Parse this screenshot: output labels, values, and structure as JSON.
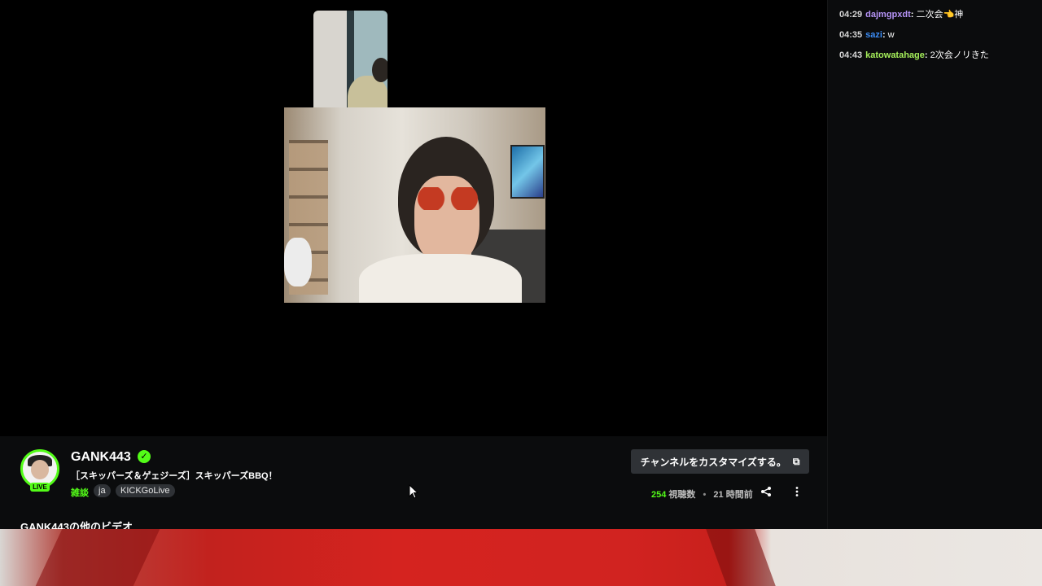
{
  "chat": {
    "messages": [
      {
        "time": "04:29",
        "user": "dajmgpxdt",
        "user_color": "#b694f7",
        "text": "二次会👈神"
      },
      {
        "time": "04:35",
        "user": "sazi",
        "user_color": "#3b8cf5",
        "text": "w"
      },
      {
        "time": "04:43",
        "user": "katowatahage",
        "user_color": "#a6f05a",
        "text": "2次会ノリきた"
      }
    ]
  },
  "channel": {
    "name": "GANK443",
    "verified_icon": "✓",
    "live_label": "LIVE",
    "stream_title": "［スキッパーズ＆ゲェジーズ］スキッパーズBBQ！",
    "category": "雑談",
    "tags": [
      "ja",
      "KICKGoLive"
    ]
  },
  "actions": {
    "customize_label": "チャンネルをカスタマイズする。",
    "external_icon": "⧉"
  },
  "stats": {
    "viewers": "254",
    "viewers_label": "視聴数",
    "separator": "•",
    "time_ago": "21 時間前"
  },
  "section": {
    "more_videos": "GANK443の他のビデオ"
  },
  "colors": {
    "accent": "#53fc18",
    "background": "#0b0c0d",
    "button": "#2f3236"
  }
}
